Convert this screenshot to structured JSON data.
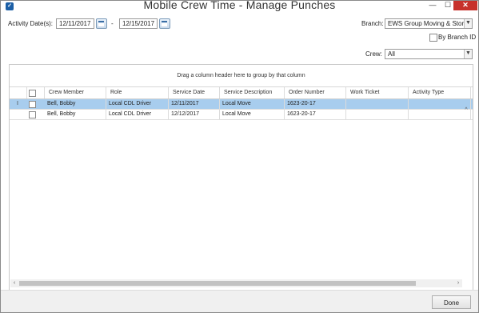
{
  "window": {
    "title": "Mobile Crew Time - Manage Punches",
    "minimize": "—",
    "maximize": "☐",
    "close": "✕"
  },
  "filters": {
    "activity_dates_label": "Activity Date(s):",
    "start_date": "12/11/2017",
    "separator": "-",
    "end_date": "12/15/2017",
    "branch_label": "Branch:",
    "branch_value": "EWS Group Moving & Stor",
    "by_branch_id_label": "By Branch ID",
    "crew_label": "Crew:",
    "crew_value": "All"
  },
  "grid": {
    "group_hint": "Drag a column header here to group by that column",
    "columns": [
      "Crew Member",
      "Role",
      "Service Date",
      "Service Description",
      "Order Number",
      "Work Ticket",
      "Activity Type"
    ],
    "rows": [
      {
        "selected": true,
        "indicator": "I",
        "cells": [
          "Bell, Bobby",
          "Local CDL Driver",
          "12/11/2017",
          "Local Move",
          "1623-20-17",
          "",
          ""
        ]
      },
      {
        "selected": false,
        "indicator": "",
        "cells": [
          "Bell, Bobby",
          "Local CDL Driver",
          "12/12/2017",
          "Local Move",
          "1623-20-17",
          "",
          ""
        ]
      }
    ],
    "scroll_left": "‹",
    "scroll_right": "›",
    "scroll_up": "^"
  },
  "footer": {
    "done_label": "Done"
  },
  "colors": {
    "selected_row": "#a8cdee",
    "close_button": "#c7312b"
  },
  "icons": {
    "app": "app-icon",
    "calendar": "calendar-icon",
    "dropdown": "chevron-down-icon"
  }
}
